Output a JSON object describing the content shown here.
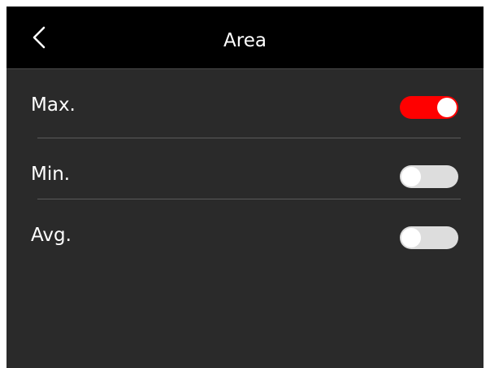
{
  "header": {
    "title": "Area",
    "back_icon": "chevron-left-icon"
  },
  "settings": [
    {
      "label": "Max.",
      "enabled": true
    },
    {
      "label": "Min.",
      "enabled": false
    },
    {
      "label": "Avg.",
      "enabled": false
    }
  ],
  "colors": {
    "header_bg": "#000000",
    "body_bg": "#2a2a2a",
    "toggle_on": "#ff0000",
    "toggle_off": "#dddddd",
    "text": "#ffffff"
  }
}
